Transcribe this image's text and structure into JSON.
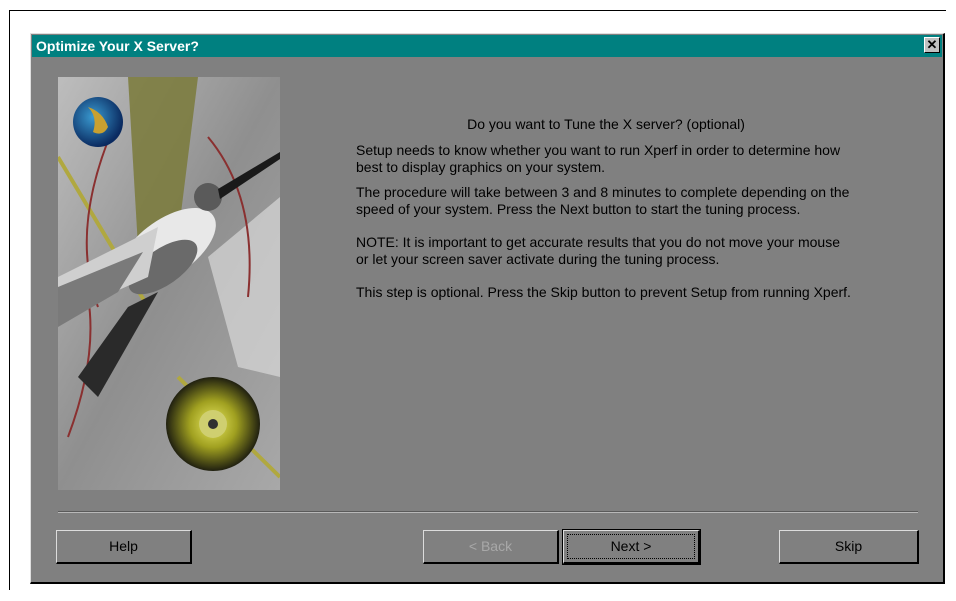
{
  "window": {
    "title": "Optimize Your X Server?",
    "close_glyph": "✕",
    "close_icon": "close-icon"
  },
  "content": {
    "heading": "Do you want to Tune the X server? (optional)",
    "paragraph1": "Setup needs to know whether you want to run Xperf in order to determine how best to display graphics on your system.",
    "paragraph2": "The procedure will take between 3 and 8 minutes to complete depending on the speed of your system. Press the Next button to start the tuning process.",
    "note": "NOTE: It is important to get accurate results that you do not move your mouse or let your screen saver activate during the tuning process.",
    "optional_text": "This step is optional. Press the Skip button to prevent Setup from running Xperf."
  },
  "buttons": {
    "help": "Help",
    "back": "< Back",
    "next": "Next >",
    "skip": "Skip"
  },
  "image": {
    "icons": [
      "hummingbird-image",
      "globe-icon",
      "cd-disc-icon"
    ]
  },
  "colors": {
    "title_bar": "#008080",
    "dialog_bg": "#808080"
  }
}
